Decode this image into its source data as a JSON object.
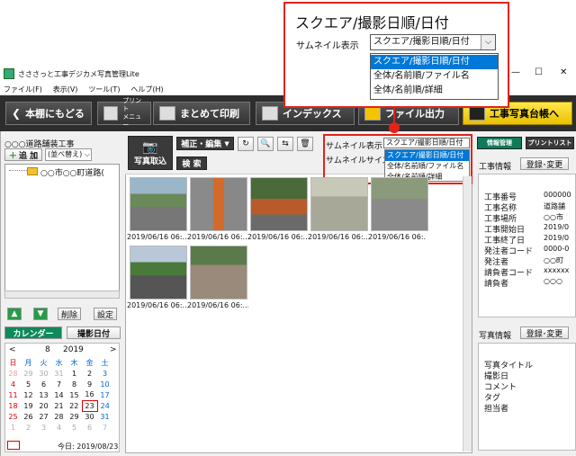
{
  "callout": {
    "title": "スクエア/撮影日順/日付",
    "label": "サムネイル表示",
    "selected": "スクエア/撮影日順/日付",
    "options": [
      "スクエア/撮影日順/日付",
      "全体/名前順/ファイル名",
      "全体/名前順/詳細"
    ]
  },
  "window": {
    "title": "さささっと工事デジカメ写真管理Lite",
    "controls": [
      "—",
      "☐",
      "✕"
    ],
    "menu": [
      "ファイル(F)",
      "表示(V)",
      "ツール(T)",
      "ヘルプ(H)"
    ]
  },
  "toolbar": {
    "back": "本棚にもどる",
    "print_menu": "プリント\nメニュー",
    "batch_print": "まとめて印刷",
    "index": "インデックス",
    "file_output": "ファイル出力",
    "ledger": "工事写真台帳へ"
  },
  "left": {
    "project": "○○○道路舗装工事",
    "add": "追 加",
    "sort": "(並べ替え)",
    "tree_item": "○○市○○町道路(",
    "delete": "削除",
    "settings": "設定",
    "tab_calendar": "カレンダー",
    "tab_date": "撮影日付",
    "cal_month": "8",
    "cal_year": "2019",
    "cal_prev": "<",
    "cal_next": ">",
    "weekdays": [
      "日",
      "月",
      "火",
      "水",
      "木",
      "金",
      "土"
    ],
    "weeks": [
      [
        "28",
        "29",
        "30",
        "31",
        "1",
        "2",
        "3"
      ],
      [
        "4",
        "5",
        "6",
        "7",
        "8",
        "9",
        "10"
      ],
      [
        "11",
        "12",
        "13",
        "14",
        "15",
        "16",
        "17"
      ],
      [
        "18",
        "19",
        "20",
        "21",
        "22",
        "23",
        "24"
      ],
      [
        "25",
        "26",
        "27",
        "28",
        "29",
        "30",
        "31"
      ],
      [
        "1",
        "2",
        "3",
        "4",
        "5",
        "6",
        "7"
      ]
    ],
    "today": "今日: 2019/08/23"
  },
  "center": {
    "import": "写真取込",
    "correct_edit": "補正・編集",
    "search": "検 索",
    "thumb_label": "サムネイル表示",
    "thumb_size_label": "サムネイルサイズ",
    "dropdown_value": "スクエア/撮影日順/日付",
    "dropdown_options": [
      "スクエア/撮影日順/日付",
      "全体/名前順/ファイル名",
      "全体/名前順/詳細"
    ],
    "photo_caption": "2019/06/16 06:..."
  },
  "right": {
    "tab_info": "情報管理",
    "tab_print": "プリントリスト",
    "project_info": "工事情報",
    "register": "登録･変更",
    "fields": [
      [
        "工事番号",
        "000000"
      ],
      [
        "工事名称",
        "道路舗"
      ],
      [
        "工事場所",
        "○○市"
      ],
      [
        "工事開始日",
        "2019/0"
      ],
      [
        "工事終了日",
        "2019/0"
      ],
      [
        "発注者コード",
        "0000-0"
      ],
      [
        "発注者",
        "○○町"
      ],
      [
        "請負者コード",
        "xxxxxx"
      ],
      [
        "請負者",
        "○○○"
      ]
    ],
    "photo_info": "写真情報",
    "photo_fields": [
      "写真タイトル",
      "撮影日",
      "コメント",
      "タグ",
      "担当者"
    ]
  },
  "colors": {
    "accent_red": "#e2231a",
    "selection": "#0078d7",
    "toolbar": "#2d2d2d",
    "ledger_btn": "#ffe84a"
  }
}
